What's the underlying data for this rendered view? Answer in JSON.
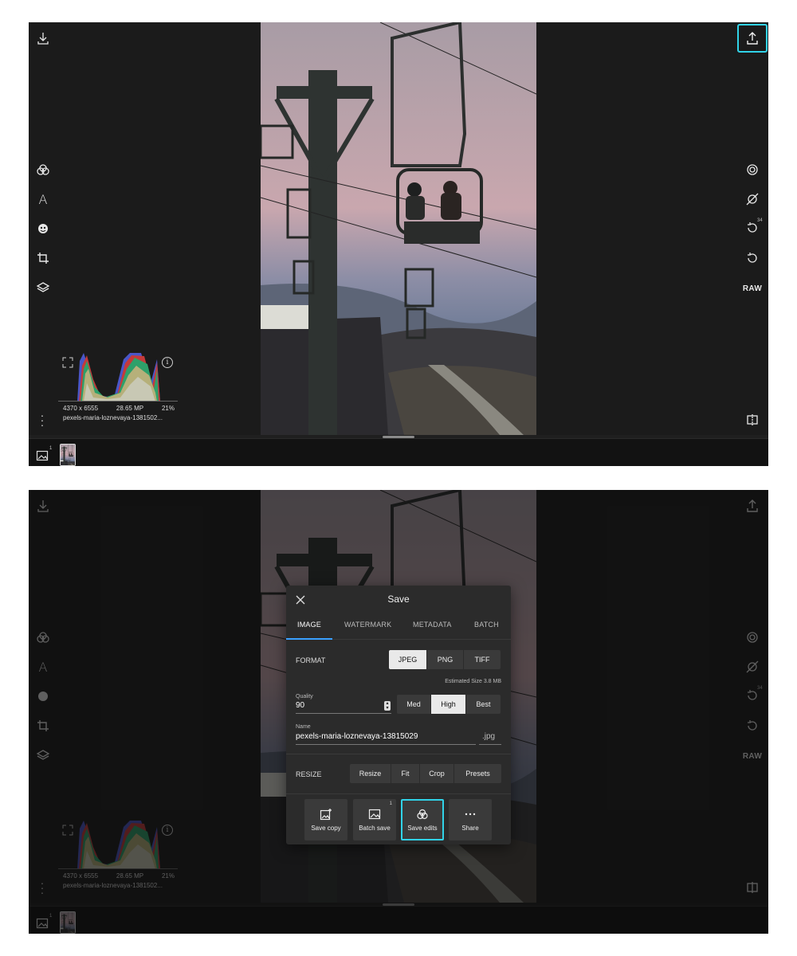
{
  "colors": {
    "accent_cyan": "#31d3e8",
    "tab_underline": "#3aa0ff",
    "panel_bg": "#1f1f1f",
    "dialog_bg": "#2b2b2b"
  },
  "toolbar_left": [
    "download-icon",
    "color-filter-icon",
    "text-icon",
    "mask-icon",
    "crop-icon",
    "layers-icon"
  ],
  "toolbar_right": {
    "icons": [
      "export-icon",
      "lens-icon",
      "hide-icon",
      "history-icon",
      "undo-icon",
      "raw-label",
      "compare-icon"
    ],
    "history_count": "34",
    "raw_label": "RAW",
    "aa_label": "A"
  },
  "image_info": {
    "dimensions": "4370 x 6555",
    "megapixels": "28.65 MP",
    "zoom": "21%",
    "filename": "pexels-maria-loznevaya-1381502..."
  },
  "filmstrip": {
    "count": "1"
  },
  "save_dialog": {
    "title": "Save",
    "tabs": [
      "IMAGE",
      "WATERMARK",
      "METADATA",
      "BATCH"
    ],
    "active_tab": "IMAGE",
    "format": {
      "label": "FORMAT",
      "options": [
        "JPEG",
        "PNG",
        "TIFF"
      ],
      "selected": "JPEG"
    },
    "estimated_size": "Estimated Size 3.8 MB",
    "quality": {
      "label": "Quality",
      "value": "90",
      "presets": [
        "Med",
        "High",
        "Best"
      ],
      "selected": "High"
    },
    "name": {
      "label": "Name",
      "value": "pexels-maria-loznevaya-13815029",
      "extension": ".jpg"
    },
    "resize": {
      "label": "RESIZE",
      "options": [
        "Resize",
        "Fit",
        "Crop",
        "Presets"
      ]
    },
    "actions": [
      {
        "label": "Save copy",
        "icon": "save-copy-icon"
      },
      {
        "label": "Batch save",
        "icon": "batch-save-icon",
        "badge": "1"
      },
      {
        "label": "Save edits",
        "icon": "save-edits-icon"
      },
      {
        "label": "Share",
        "icon": "more-dots-icon"
      }
    ]
  }
}
